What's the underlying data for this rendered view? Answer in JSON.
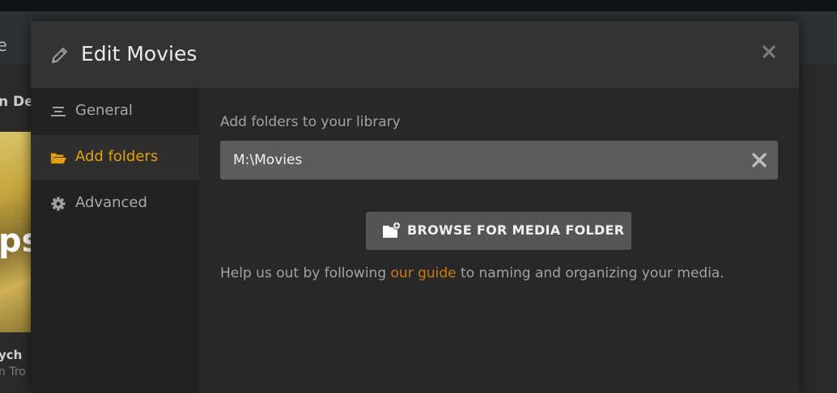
{
  "background": {
    "header_text": "e",
    "section_title": "n De",
    "poster_text": "ps",
    "item_title": "ych",
    "item_subtitle": "n Tro"
  },
  "modal": {
    "title": "Edit Movies",
    "close_icon": "close-icon"
  },
  "sidebar": {
    "items": [
      {
        "label": "General",
        "icon": "general-lines-icon",
        "active": false
      },
      {
        "label": "Add folders",
        "icon": "folder-open-icon",
        "active": true
      },
      {
        "label": "Advanced",
        "icon": "gear-icon",
        "active": false
      }
    ]
  },
  "main": {
    "field_label": "Add folders to your library",
    "folder_value": "M:\\Movies",
    "browse_label": "BROWSE FOR MEDIA FOLDER",
    "help": {
      "before": "Help us out by following ",
      "link": "our guide",
      "after": " to naming and organizing your media."
    }
  },
  "colors": {
    "accent": "#e5a00d",
    "link": "#cc7b19",
    "modal_bg": "#282828",
    "sidebar_bg": "#222222"
  }
}
